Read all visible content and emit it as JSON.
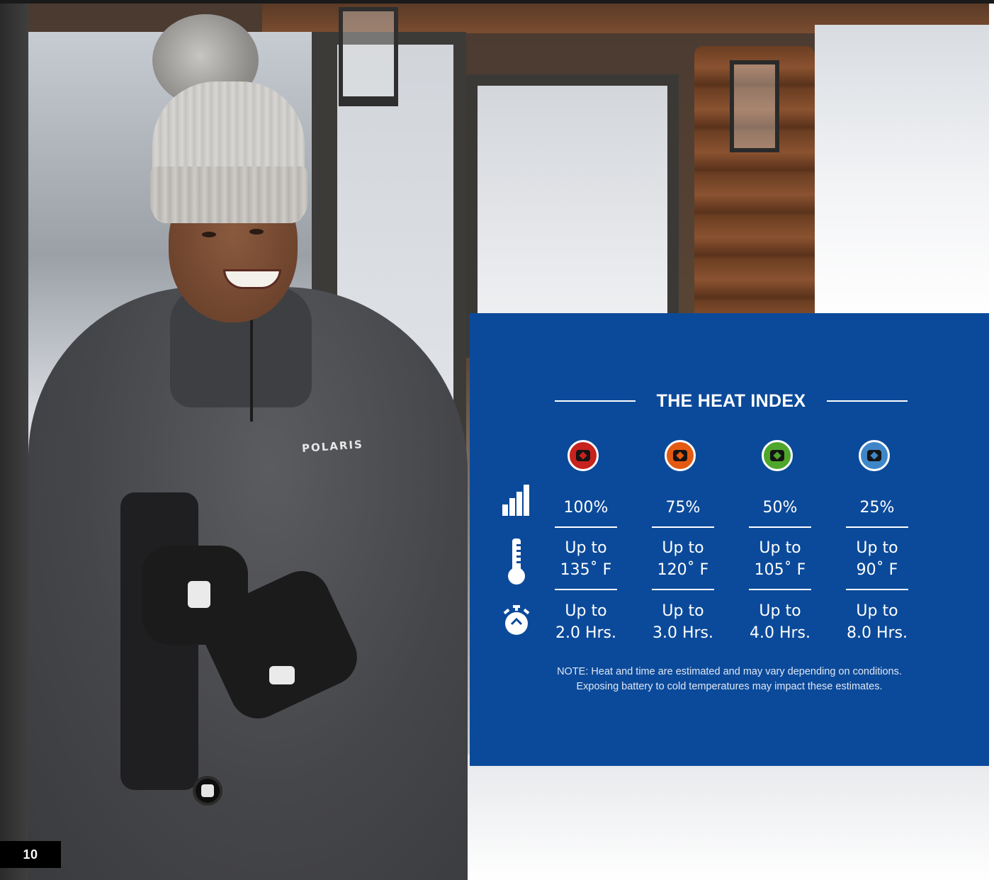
{
  "page": {
    "number": "10"
  },
  "photo": {
    "brand_on_shirt": "POLARIS"
  },
  "heat_index": {
    "title": "THE HEAT INDEX",
    "row_icons": [
      "signal-strength-icon",
      "thermometer-icon",
      "stopwatch-icon"
    ],
    "levels": [
      {
        "indicator_color": "#c8221e",
        "power": "100%",
        "temp_line1": "Up to",
        "temp_line2": "135˚ F",
        "time_line1": "Up to",
        "time_line2": "2.0 Hrs."
      },
      {
        "indicator_color": "#e45a12",
        "power": "75%",
        "temp_line1": "Up to",
        "temp_line2": "120˚ F",
        "time_line1": "Up to",
        "time_line2": "3.0 Hrs."
      },
      {
        "indicator_color": "#4fa62c",
        "power": "50%",
        "temp_line1": "Up to",
        "temp_line2": "105˚ F",
        "time_line1": "Up to",
        "time_line2": "4.0 Hrs."
      },
      {
        "indicator_color": "#3f86c8",
        "power": "25%",
        "temp_line1": "Up to",
        "temp_line2": "90˚ F",
        "time_line1": "Up to",
        "time_line2": "8.0 Hrs."
      }
    ],
    "note_line1": "NOTE: Heat and time are estimated and may vary depending on conditions.",
    "note_line2": "Exposing battery to cold temperatures may impact these estimates."
  },
  "colors": {
    "panel_background": "#0b4a9a",
    "page_number_background": "#000000"
  }
}
